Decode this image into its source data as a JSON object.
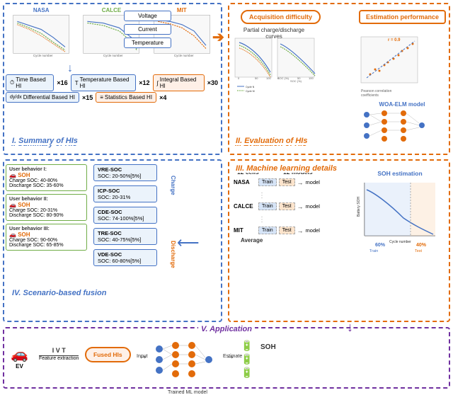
{
  "sections": {
    "top_left": {
      "title": "I. Summary of HIs",
      "charts": [
        {
          "label": "NASA",
          "color": "#4472C4"
        },
        {
          "label": "CALCE",
          "color": "#70AD47"
        },
        {
          "label": "MIT",
          "color": "#E26B0A"
        }
      ],
      "inputs": [
        "Voltage",
        "Current",
        "Temperature"
      ],
      "hi_items": [
        {
          "icon": "⏱",
          "label": "Time Based HI",
          "multiplier": "×16"
        },
        {
          "icon": "T",
          "label": "Temperature Based HI",
          "multiplier": "×12"
        },
        {
          "icon": "∫",
          "label": "Integral Based HI",
          "multiplier": "×30"
        },
        {
          "icon": "dy/dx",
          "label": "Differential Based HI",
          "multiplier": "×15"
        },
        {
          "icon": "≡",
          "label": "Statistics Based HI",
          "multiplier": "×4"
        }
      ]
    },
    "top_right": {
      "title": "II. Evaluation of HIs",
      "acquisition_difficulty": "Acquisition difficulty",
      "estimation_performance": "Estimation performance",
      "partial_label": "Partial charge/discharge curves",
      "pearson_label": "Pearson correlation coefficients",
      "r_value": "r = 0.9",
      "model": "WOA-ELM model"
    },
    "mid_left": {
      "title": "IV. Scenario-based fusion",
      "behaviors": [
        {
          "label": "User behavior I:",
          "soh": "SOH",
          "charge": "Charge SOC: 40-80%",
          "discharge": "Discharge SOC: 35-60%"
        },
        {
          "label": "User behavior II:",
          "soh": "SOH",
          "charge": "Charge SOC: 20-31%",
          "discharge": "Discharge SOC: 80-90%"
        },
        {
          "label": "User behavior III:",
          "soh": "SOH",
          "charge": "Charge SOC: 90-60%",
          "discharge": "Discharge SOC: 65-85%"
        }
      ],
      "soc_items": [
        {
          "name": "VRE-SOC",
          "range": "SOC: 20-50%[5%]"
        },
        {
          "name": "ICP-SOC",
          "range": "SOC: 20-31%"
        },
        {
          "name": "CDE-SOC",
          "range": "SOC: 74-100%[5%]"
        },
        {
          "name": "TRE-SOC",
          "range": "SOC: 40-75%[5%]"
        },
        {
          "name": "VDE-SOC",
          "range": "SOC: 60-80%[5%]"
        }
      ],
      "charge_label": "Charge",
      "discharge_label": "Discharge"
    },
    "mid_right": {
      "title": "III. Machine learning details",
      "cells": "12 cells",
      "models": "12 models",
      "datasets": [
        "NASA",
        "CALCE",
        "MIT"
      ],
      "average_label": "Average",
      "soh_estimation": "SOH estimation",
      "train_label": "Train",
      "test_label": "Test",
      "model_label": "model",
      "battery_train": "60%",
      "battery_test": "40%",
      "train_label2": "Train",
      "test_label2": "Test",
      "cycle_label": "Cycle number",
      "battery_soh_label": "Battery SOH"
    },
    "bottom": {
      "title": "V. Application",
      "ev_label": "EV",
      "ivt_label": "I V T",
      "feature_label": "Feature extraction",
      "fused_hi_label": "Fused HIs",
      "input_label": "Input",
      "trained_ml_label": "Trained ML model",
      "estimate_label": "Estimate",
      "soh_label": "SOH"
    }
  },
  "colors": {
    "blue": "#4472C4",
    "orange": "#E26B0A",
    "green": "#70AD47",
    "purple": "#7030A0",
    "light_blue": "#EBF3FB",
    "light_orange": "#FEF0E7"
  },
  "icons": {
    "clock": "⏱",
    "integral": "∫",
    "derivative": "dy/dx",
    "stats": "≡",
    "temperature": "T",
    "car": "🚗",
    "battery": "🔋",
    "arrow_right": "→",
    "arrow_down": "↓",
    "arrow_left": "←"
  }
}
